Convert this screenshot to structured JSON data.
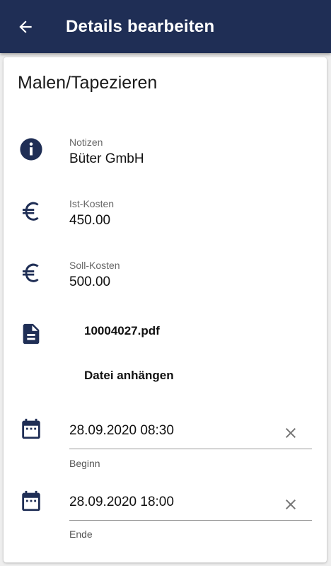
{
  "header": {
    "title": "Details bearbeiten",
    "back_icon": "arrow-left-icon",
    "background": "#1f2e55"
  },
  "card": {
    "title": "Malen/Tapezieren",
    "notes": {
      "icon": "info-icon",
      "label": "Notizen",
      "value": "Büter GmbH"
    },
    "actual_cost": {
      "icon": "euro-icon",
      "label": "Ist-Kosten",
      "value": "450.00"
    },
    "target_cost": {
      "icon": "euro-icon",
      "label": "Soll-Kosten",
      "value": "500.00"
    },
    "attachment": {
      "icon": "document-icon",
      "file_name": "10004027.pdf",
      "attach_label": "Datei anhängen"
    },
    "start": {
      "icon": "calendar-icon",
      "value": "28.09.2020 08:30",
      "helper": "Beginn",
      "clear_icon": "close-icon"
    },
    "end": {
      "icon": "calendar-icon",
      "value": "28.09.2020 18:00",
      "helper": "Ende",
      "clear_icon": "close-icon"
    }
  },
  "colors": {
    "icon": "#1f2e55",
    "clear": "#757575"
  }
}
